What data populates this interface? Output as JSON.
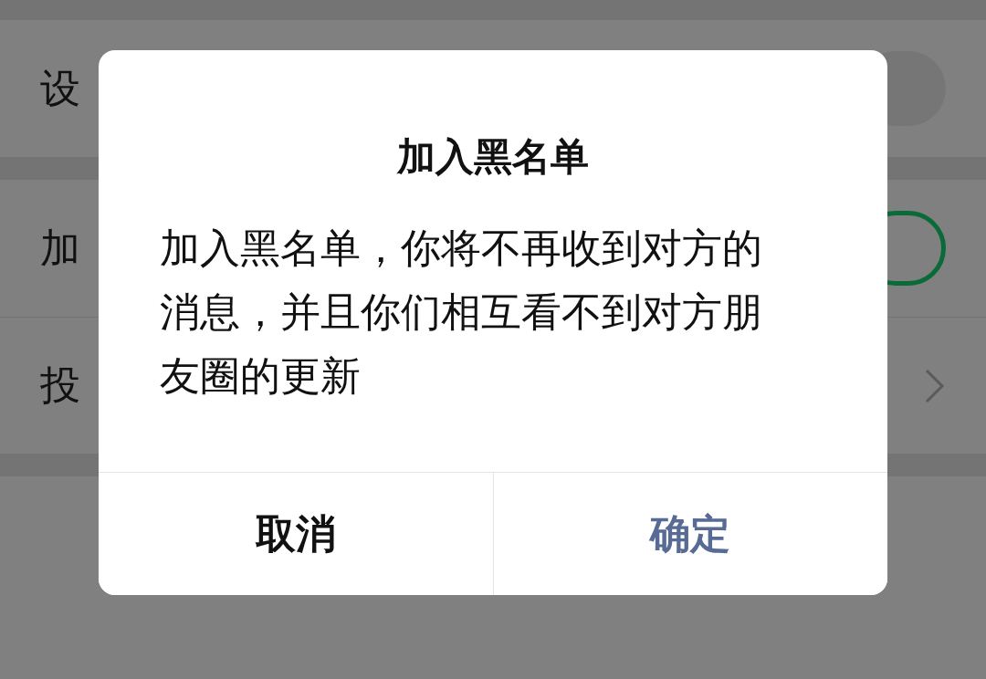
{
  "settings": [
    {
      "kind": "toggle",
      "label": "设",
      "on": false
    },
    {
      "kind": "toggle",
      "label": "加",
      "on": true
    },
    {
      "kind": "link",
      "label": "投"
    }
  ],
  "dialog": {
    "title": "加入黑名单",
    "message": "加入黑名单，你将不再收到对方的消息，并且你们相互看不到对方朋友圈的更新",
    "buttons": [
      {
        "label": "取消",
        "primary": false
      },
      {
        "label": "确定",
        "primary": true
      }
    ]
  }
}
